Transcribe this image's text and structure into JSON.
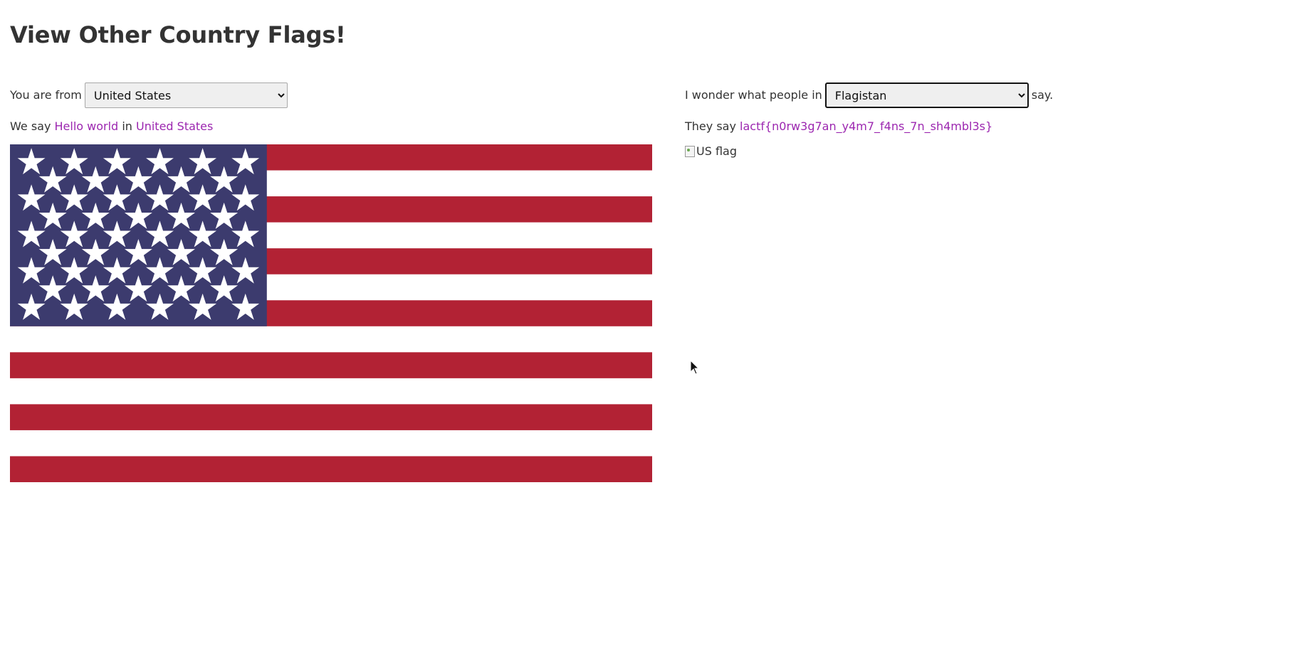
{
  "page": {
    "title": "View Other Country Flags!"
  },
  "left": {
    "from_label": "You are from",
    "from_select": {
      "selected": "United States",
      "options": [
        "United States"
      ]
    },
    "we_say_prefix": "We say",
    "greeting": "Hello world",
    "in_word": "in",
    "country": "United States",
    "flag_colors": {
      "red": "#b22234",
      "white": "#ffffff",
      "blue": "#3c3b6e"
    },
    "flag_icon": "us-flag-icon"
  },
  "right": {
    "wonder_prefix": "I wonder what people in",
    "wonder_select": {
      "selected": "Flagistan",
      "options": [
        "Flagistan"
      ]
    },
    "wonder_suffix": "say.",
    "they_say_prefix": "They say",
    "secret": "lactf{n0rw3g7an_y4m7_f4ns_7n_sh4mbl3s}",
    "broken_image_alt": "US flag",
    "broken_icon": "broken-image-icon"
  },
  "colors": {
    "link": "#9c27b0",
    "text": "#333333"
  },
  "cursor": {
    "icon": "mouse-pointer-icon"
  }
}
